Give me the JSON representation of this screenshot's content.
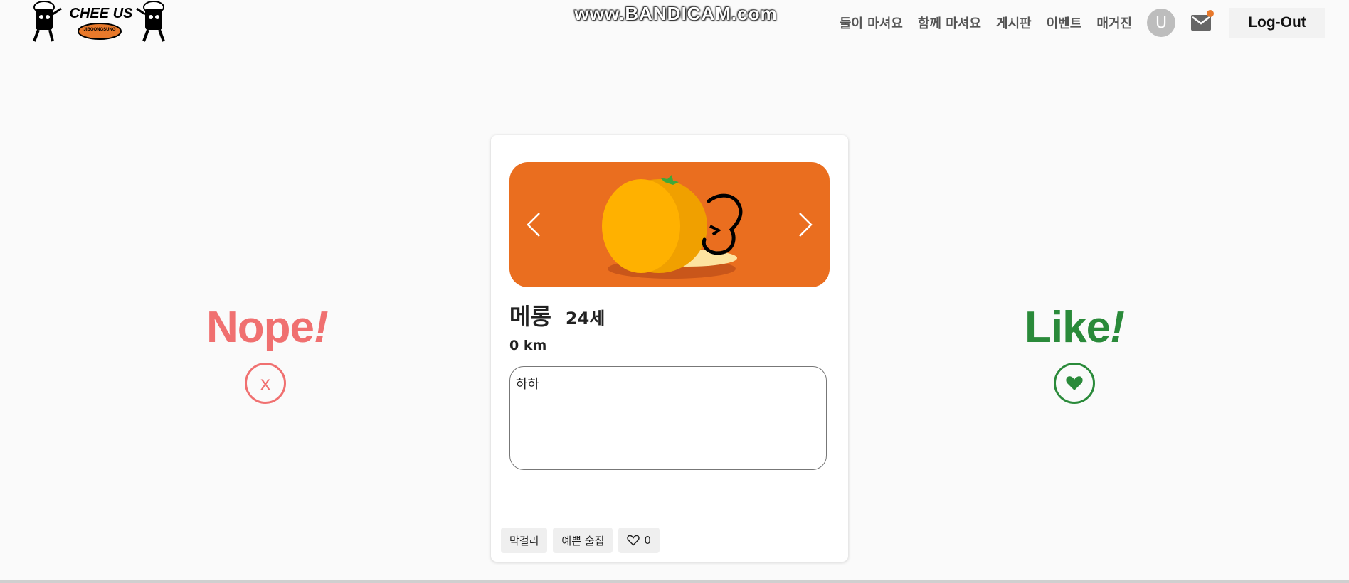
{
  "watermark": "www.BANDICAM.com",
  "logo": {
    "title": "CHEE US",
    "subtitle": "JIBOONGSUNG"
  },
  "nav": {
    "items": [
      "둘이 마셔요",
      "함께 마셔요",
      "게시판",
      "이벤트",
      "매거진"
    ],
    "avatar_letter": "U",
    "logout_label": "Log-Out",
    "accent_color": "#e8792b"
  },
  "swipe": {
    "nope_text": "Nope",
    "nope_mark": "!",
    "nope_button": "x",
    "nope_color": "#f07070",
    "like_text": "Like",
    "like_mark": "!",
    "like_color": "#2a8a3a"
  },
  "profile": {
    "name": "메롱",
    "age": "24세",
    "distance": "0 km",
    "bio": "하하",
    "tags": [
      "막걸리",
      "예쁜 술집"
    ],
    "like_count": "0"
  },
  "icons": {
    "prev": "chevron-left-icon",
    "next": "chevron-right-icon",
    "mail": "mail-icon",
    "heart": "heart-icon"
  }
}
